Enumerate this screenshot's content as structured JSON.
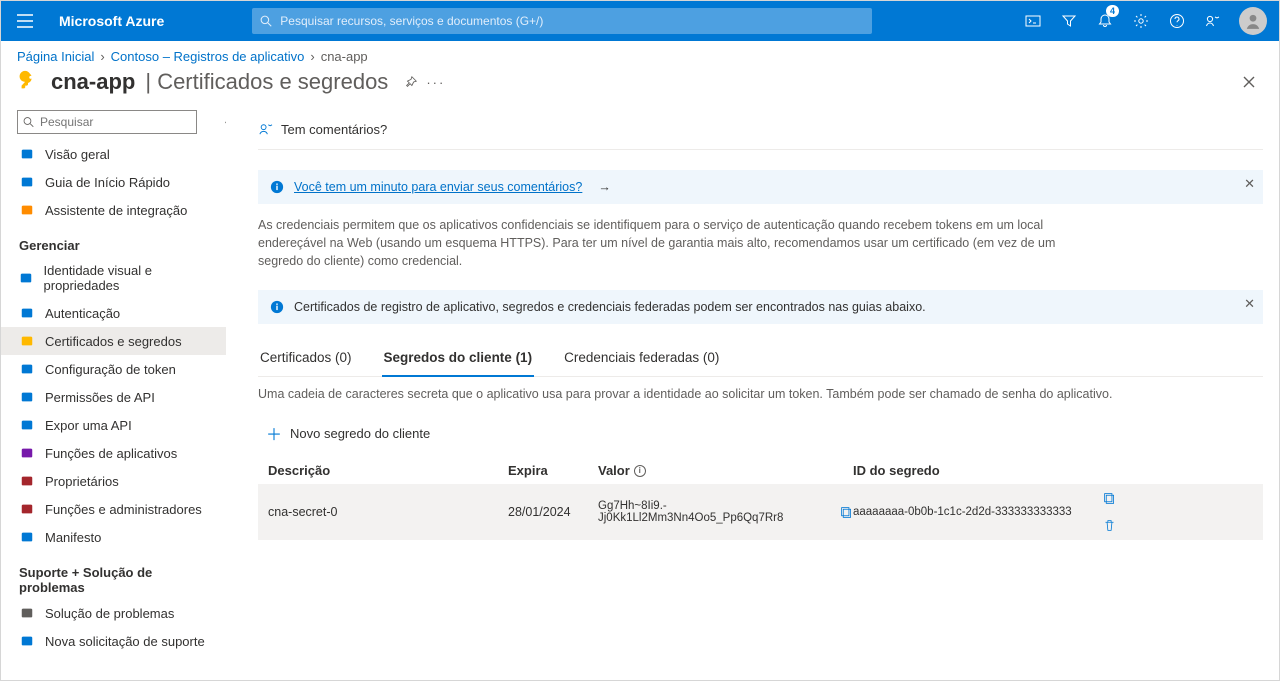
{
  "topbar": {
    "brand": "Microsoft Azure",
    "search_placeholder": "Pesquisar recursos, serviços e documentos (G+/)",
    "notification_count": "4"
  },
  "breadcrumb": {
    "items": [
      "Página Inicial",
      "Contoso – Registros de aplicativo",
      "cna-app"
    ]
  },
  "title": {
    "app": "cna-app",
    "section": "Certificados e segredos"
  },
  "sidebar": {
    "search_placeholder": "Pesquisar",
    "top": [
      {
        "label": "Visão geral",
        "icon": "globe-icon",
        "color": "#0078d4"
      },
      {
        "label": "Guia de Início Rápido",
        "icon": "cloud-icon",
        "color": "#0078d4"
      },
      {
        "label": "Assistente de integração",
        "icon": "rocket-icon",
        "color": "#ff8c00"
      }
    ],
    "group1_label": "Gerenciar",
    "group1": [
      {
        "label": "Identidade visual e propriedades",
        "icon": "card-icon",
        "color": "#0078d4"
      },
      {
        "label": "Autenticação",
        "icon": "auth-icon",
        "color": "#0078d4"
      },
      {
        "label": "Certificados e segredos",
        "icon": "key-icon",
        "color": "#ffb900",
        "active": true
      },
      {
        "label": "Configuração de token",
        "icon": "token-icon",
        "color": "#0078d4"
      },
      {
        "label": "Permissões de API",
        "icon": "permissions-icon",
        "color": "#0078d4"
      },
      {
        "label": "Expor uma API",
        "icon": "expose-icon",
        "color": "#0078d4"
      },
      {
        "label": "Funções de aplicativos",
        "icon": "approles-icon",
        "color": "#7719aa"
      },
      {
        "label": "Proprietários",
        "icon": "owners-icon",
        "color": "#a4262c"
      },
      {
        "label": "Funções e administradores",
        "icon": "admins-icon",
        "color": "#a4262c"
      },
      {
        "label": "Manifesto",
        "icon": "manifest-icon",
        "color": "#0078d4"
      }
    ],
    "group2_label": "Suporte + Solução de problemas",
    "group2": [
      {
        "label": "Solução de problemas",
        "icon": "trouble-icon",
        "color": "#605e5c"
      },
      {
        "label": "Nova solicitação de suporte",
        "icon": "support-icon",
        "color": "#0078d4"
      }
    ]
  },
  "main": {
    "feedback_label": "Tem comentários?",
    "banner1_text": "Você tem um minuto para enviar seus comentários?",
    "desc_para": "As credenciais permitem que os aplicativos confidenciais se identifiquem para o serviço de autenticação quando recebem tokens em um local endereçável na Web (usando um esquema HTTPS). Para ter um nível de garantia mais alto, recomendamos usar um certificado (em vez de um segredo do cliente) como credencial.",
    "banner2_text": "Certificados de registro de aplicativo, segredos e credenciais federadas podem ser encontrados nas guias abaixo.",
    "tabs": [
      {
        "label": "Certificados (0)"
      },
      {
        "label": "Segredos do cliente (1)",
        "active": true
      },
      {
        "label": "Credenciais federadas (0)"
      }
    ],
    "tab_desc": "Uma cadeia de caracteres secreta que o aplicativo usa para provar a identidade ao solicitar um token. Também pode ser chamado de senha do aplicativo.",
    "new_secret_label": "Novo segredo do cliente",
    "columns": {
      "desc": "Descrição",
      "expires": "Expira",
      "value": "Valor",
      "id": "ID do segredo"
    },
    "rows": [
      {
        "desc": "cna-secret-0",
        "expires": "28/01/2024",
        "value": "Gg7Hh~8Ii9.-Jj0Kk1Ll2Mm3Nn4Oo5_Pp6Qq7Rr8",
        "id": "aaaaaaaa-0b0b-1c1c-2d2d-333333333333"
      }
    ]
  }
}
